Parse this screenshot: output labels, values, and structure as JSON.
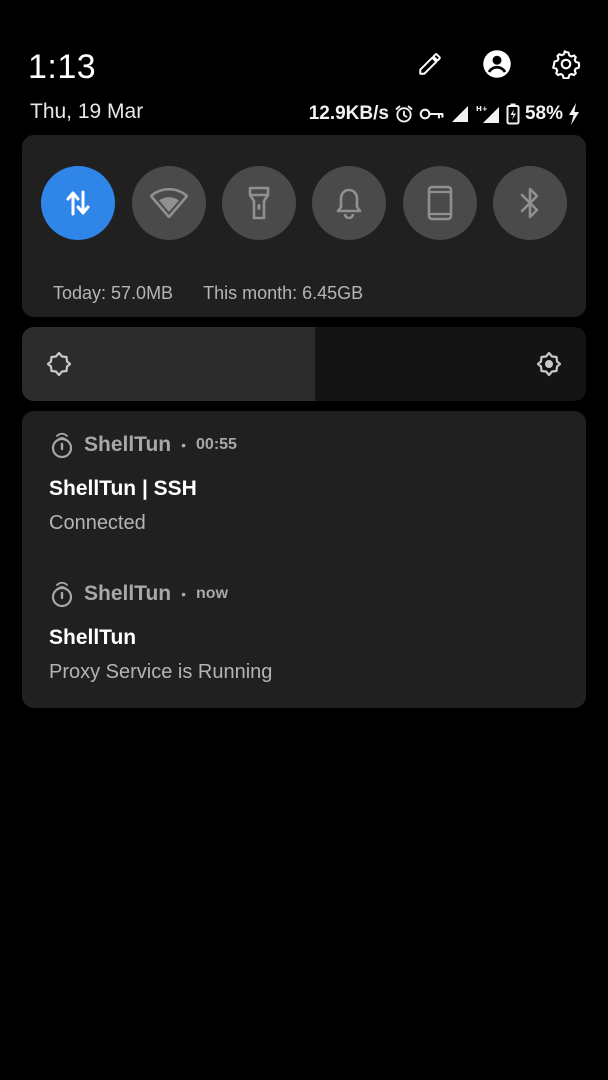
{
  "header": {
    "time": "1:13",
    "date": "Thu, 19 Mar",
    "net_speed": "12.9KB/s",
    "battery_percent": "58%",
    "icons": [
      "edit-icon",
      "account-icon",
      "settings-icon"
    ]
  },
  "quick_settings": {
    "tiles": [
      {
        "name": "mobile-data",
        "icon": "data-arrows-icon",
        "active": true
      },
      {
        "name": "wifi",
        "icon": "wifi-icon",
        "active": false
      },
      {
        "name": "flashlight",
        "icon": "flashlight-icon",
        "active": false
      },
      {
        "name": "sound",
        "icon": "bell-icon",
        "active": false
      },
      {
        "name": "auto-rotate",
        "icon": "phone-icon",
        "active": false
      },
      {
        "name": "bluetooth",
        "icon": "bluetooth-icon",
        "active": false
      }
    ],
    "today_usage": "Today: 57.0MB",
    "month_usage": "This month: 6.45GB",
    "active_color": "#2f86e8"
  },
  "brightness": {
    "level": 0.52
  },
  "notifications": [
    {
      "app": "ShellTun",
      "time": "00:55",
      "title": "ShellTun | SSH",
      "text": "Connected"
    },
    {
      "app": "ShellTun",
      "time": "now",
      "title": "ShellTun",
      "text": "Proxy Service is Running"
    }
  ]
}
